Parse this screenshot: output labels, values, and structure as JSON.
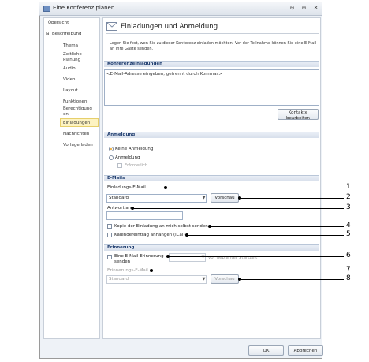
{
  "window": {
    "title": "Eine Konferenz planen"
  },
  "nav": {
    "items": [
      {
        "label": "Übersicht"
      },
      {
        "label": "Beschreibung",
        "expander": "⊟"
      },
      {
        "label": "Thema"
      },
      {
        "label": "Zeitliche Planung"
      },
      {
        "label": "Audio"
      },
      {
        "label": "Video"
      },
      {
        "label": "Layout"
      },
      {
        "label": "Funktionen"
      },
      {
        "label": "Berechtigungen"
      },
      {
        "label": "Einladungen"
      },
      {
        "label": "Nachrichten"
      },
      {
        "label": "Vorlage laden"
      }
    ],
    "selected": "Einladungen"
  },
  "header": {
    "title": "Einladungen und Anmeldung",
    "description": "Legen Sie fest, wen Sie zu dieser Konferenz einladen möchten. Vor der Teilnahme können Sie eine E-Mail an Ihre Gäste senden."
  },
  "invitations": {
    "section": "Konferenzeinladungen",
    "placeholder": "<E-Mail-Adresse eingeben, getrennt durch Kommas>",
    "contacts_button": "Kontakte bearbeiten"
  },
  "registration": {
    "section": "Anmeldung",
    "no_registration": "Keine Anmeldung",
    "registration": "Anmeldung",
    "required": "Erforderlich"
  },
  "emails": {
    "section": "E-Mails",
    "invitation_label": "Einladungs-E-Mail",
    "invitation_value": "Standard",
    "preview_button": "Vorschau",
    "reply_label": "Antwort an",
    "reply_value": "",
    "copy_to_self": "Kopie der Einladung an mich selbst senden",
    "attach_calendar": "Kalendereintrag anhängen (iCal)"
  },
  "reminder": {
    "section": "Erinnerung",
    "send_reminder": "Eine E-Mail-Erinnerung senden",
    "before_start": "vor geplanter Startzeit",
    "reminder_email_label": "Erinnerungs-E-Mail",
    "reminder_email_value": "Standard",
    "preview_button": "Vorschau"
  },
  "footer": {
    "ok": "OK",
    "cancel": "Abbrechen"
  },
  "callouts": [
    "1",
    "2",
    "3",
    "4",
    "5",
    "6",
    "7",
    "8"
  ]
}
